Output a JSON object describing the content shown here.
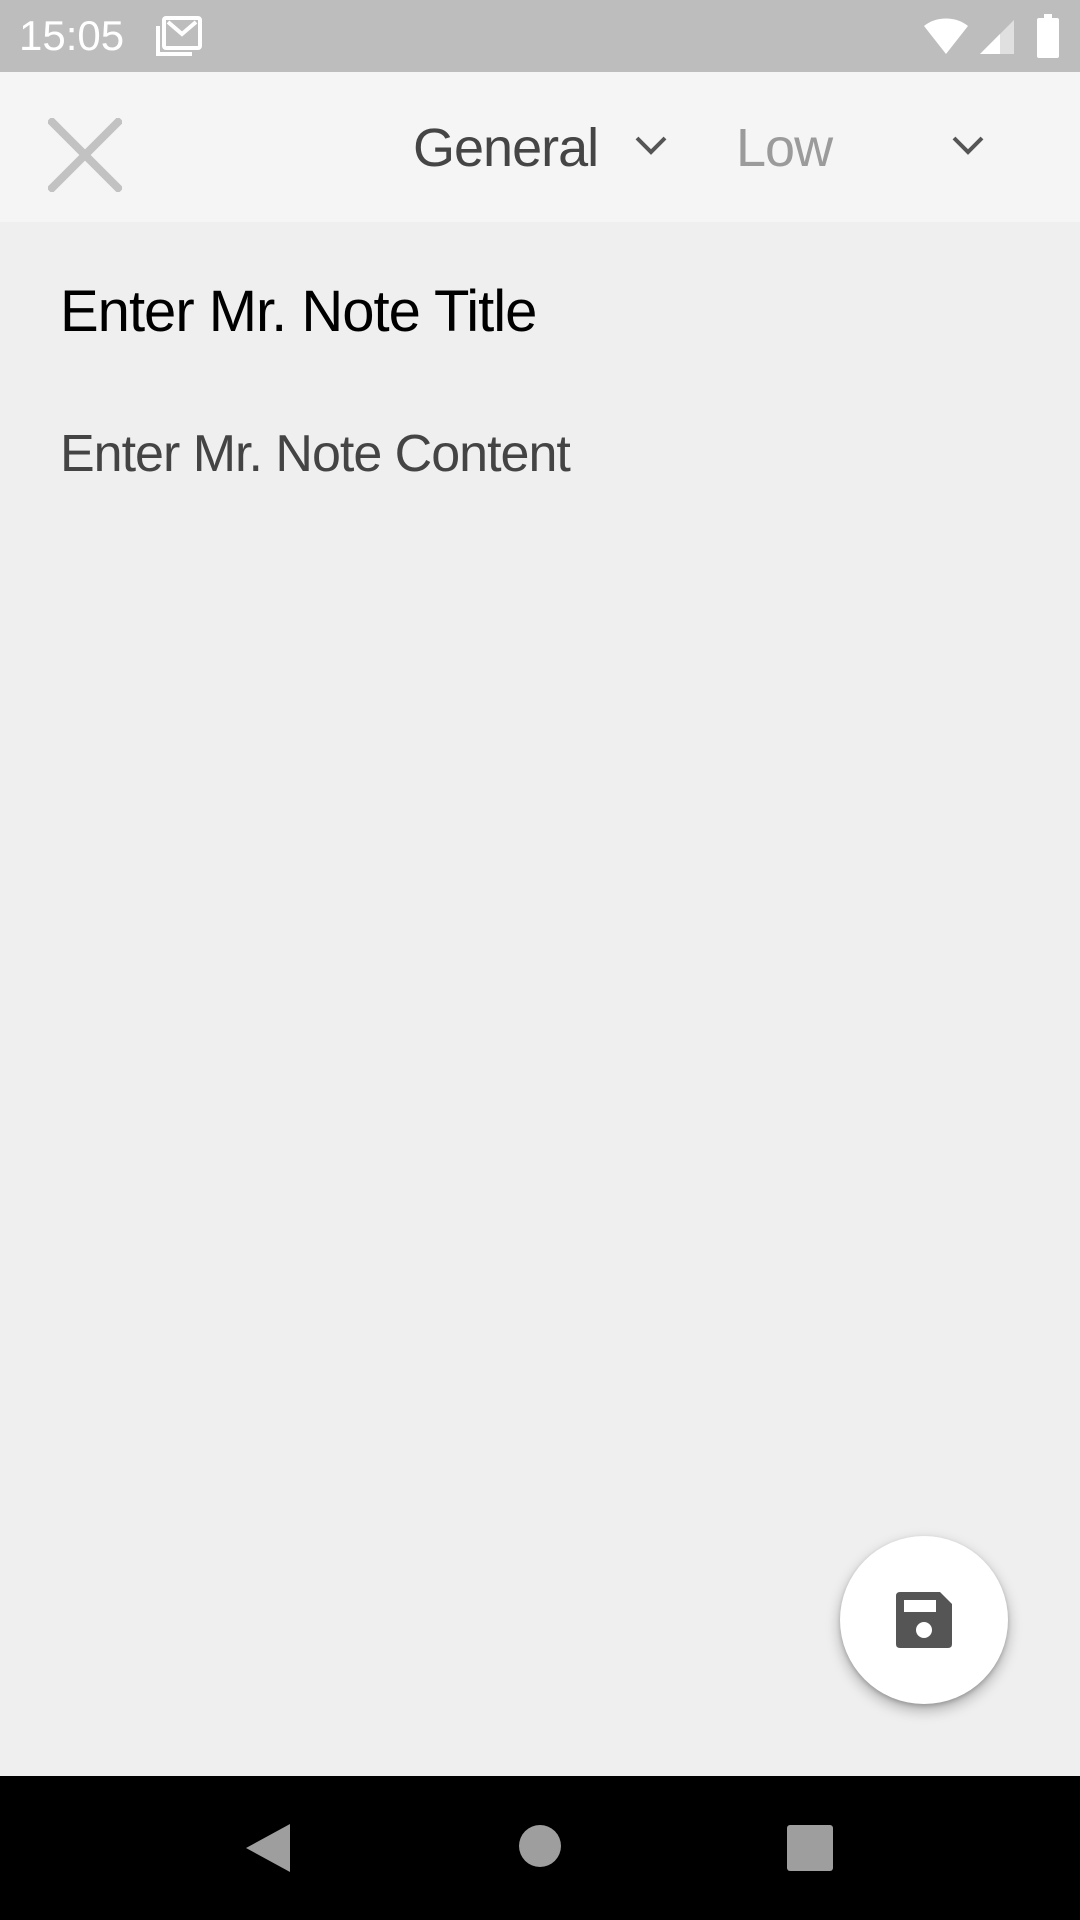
{
  "status_bar": {
    "time": "15:05",
    "icons": [
      "mail-icon",
      "wifi-icon",
      "signal-icon",
      "battery-icon"
    ]
  },
  "toolbar": {
    "close_icon": "close-icon",
    "category": {
      "selected": "General",
      "icon": "chevron-down-icon"
    },
    "priority": {
      "selected": "Low",
      "icon": "chevron-down-icon"
    }
  },
  "editor": {
    "title_placeholder": "Enter Mr. Note Title",
    "content_placeholder": "Enter Mr. Note Content"
  },
  "fab": {
    "icon": "save-icon"
  },
  "nav_bar": {
    "icons": [
      "back-icon",
      "home-icon",
      "recents-icon"
    ]
  },
  "colors": {
    "status_bar": "#bdbdbd",
    "toolbar": "#f5f5f5",
    "background": "#efefef",
    "icon_dark": "#555555",
    "icon_light": "#c2c2c2",
    "nav_bar": "#000000",
    "nav_icon": "#9e9e9e"
  }
}
